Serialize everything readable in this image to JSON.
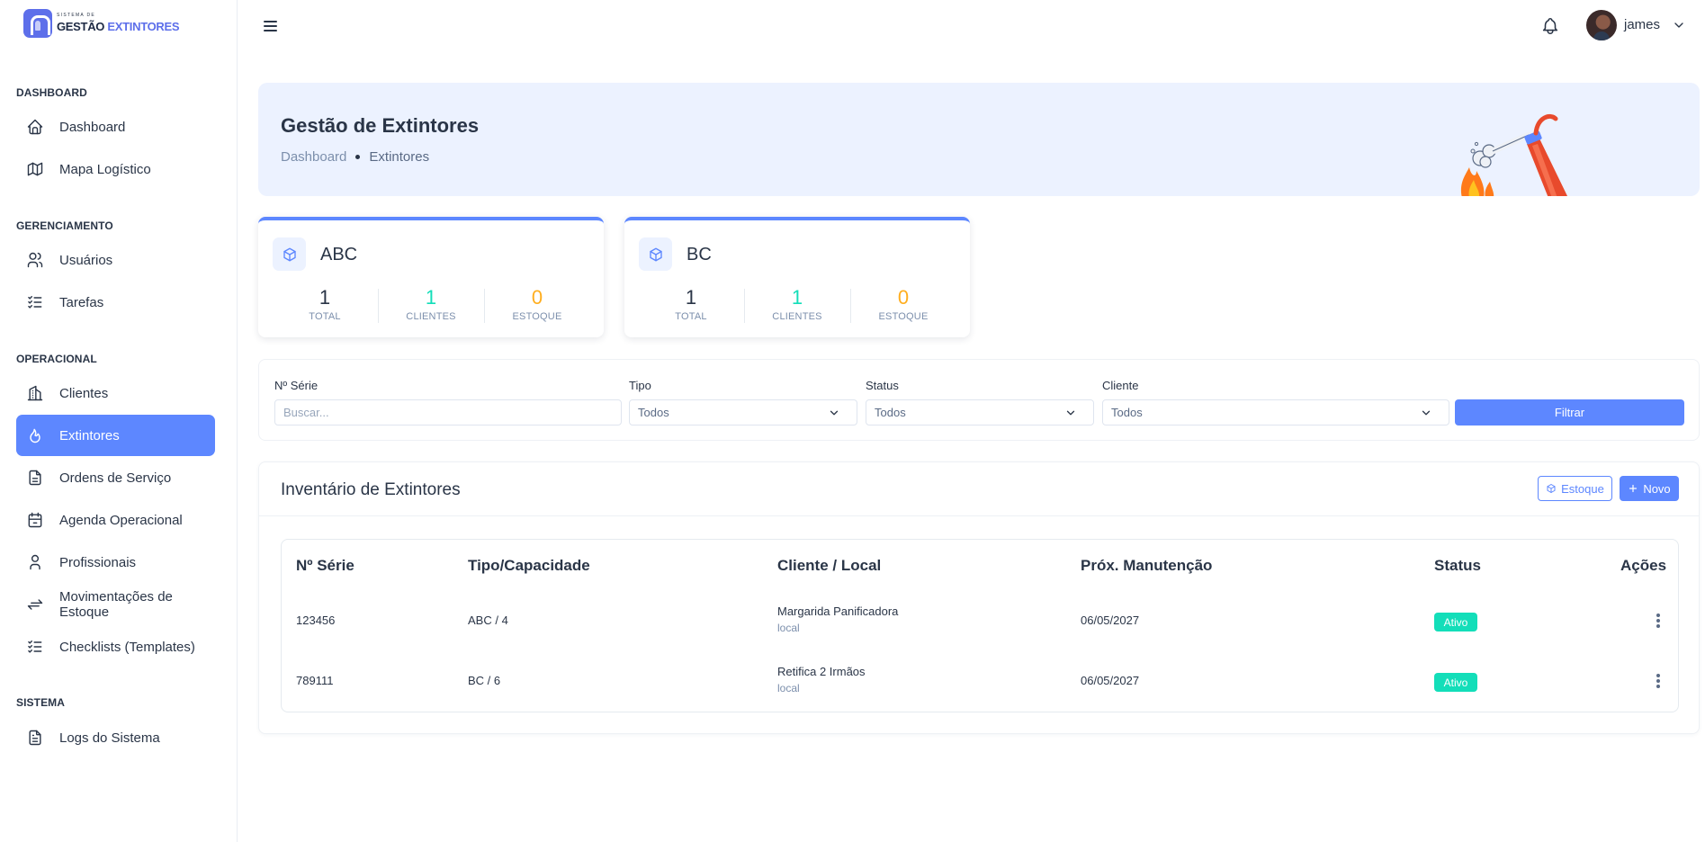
{
  "app": {
    "logo_small": "SISTEMA DE",
    "logo_part1": "GESTÃO",
    "logo_part2": "EXTINTORES"
  },
  "sidebar": {
    "sections": [
      {
        "title": "DASHBOARD"
      },
      {
        "title": "GERENCIAMENTO"
      },
      {
        "title": "OPERACIONAL"
      },
      {
        "title": "SISTEMA"
      }
    ],
    "items": [
      {
        "label": "Dashboard",
        "icon": "home-icon"
      },
      {
        "label": "Mapa Logístico",
        "icon": "map-icon"
      },
      {
        "label": "Usuários",
        "icon": "users-icon"
      },
      {
        "label": "Tarefas",
        "icon": "list-check-icon"
      },
      {
        "label": "Clientes",
        "icon": "building-icon"
      },
      {
        "label": "Extintores",
        "icon": "flame-icon",
        "active": true
      },
      {
        "label": "Ordens de Serviço",
        "icon": "file-icon"
      },
      {
        "label": "Agenda Operacional",
        "icon": "calendar-icon"
      },
      {
        "label": "Profissionais",
        "icon": "user-icon"
      },
      {
        "label": "Movimentações de Estoque",
        "icon": "arrows-exchange-icon"
      },
      {
        "label": "Checklists (Templates)",
        "icon": "list-check-icon"
      },
      {
        "label": "Logs do Sistema",
        "icon": "file-text-icon"
      }
    ]
  },
  "topbar": {
    "username": "james"
  },
  "hero": {
    "title": "Gestão de Extintores",
    "breadcrumb": [
      "Dashboard",
      "Extintores"
    ]
  },
  "summary_cards": [
    {
      "title": "ABC",
      "stats": [
        {
          "value": "1",
          "label": "TOTAL"
        },
        {
          "value": "1",
          "label": "CLIENTES"
        },
        {
          "value": "0",
          "label": "ESTOQUE"
        }
      ]
    },
    {
      "title": "BC",
      "stats": [
        {
          "value": "1",
          "label": "TOTAL"
        },
        {
          "value": "1",
          "label": "CLIENTES"
        },
        {
          "value": "0",
          "label": "ESTOQUE"
        }
      ]
    }
  ],
  "filters": {
    "serie_label": "Nº Série",
    "serie_placeholder": "Buscar...",
    "tipo_label": "Tipo",
    "tipo_value": "Todos",
    "status_label": "Status",
    "status_value": "Todos",
    "cliente_label": "Cliente",
    "cliente_value": "Todos",
    "submit_label": "Filtrar"
  },
  "inventory": {
    "title": "Inventário de Extintores",
    "estoque_label": "Estoque",
    "novo_label": "Novo",
    "columns": [
      "Nº Série",
      "Tipo/Capacidade",
      "Cliente / Local",
      "Próx. Manutenção",
      "Status",
      "Ações"
    ],
    "rows": [
      {
        "serie": "123456",
        "tipo": "ABC / 4",
        "cliente": "Margarida Panificadora",
        "local": "local",
        "manutencao": "06/05/2027",
        "status": "Ativo"
      },
      {
        "serie": "789111",
        "tipo": "BC / 6",
        "cliente": "Retifica 2 Irmãos",
        "local": "local",
        "manutencao": "06/05/2027",
        "status": "Ativo"
      }
    ]
  },
  "colors": {
    "primary": "#5d87ff",
    "success": "#13deb9",
    "warning": "#ffae1f",
    "text": "#2a3547",
    "hero_bg": "#ecf2ff"
  }
}
